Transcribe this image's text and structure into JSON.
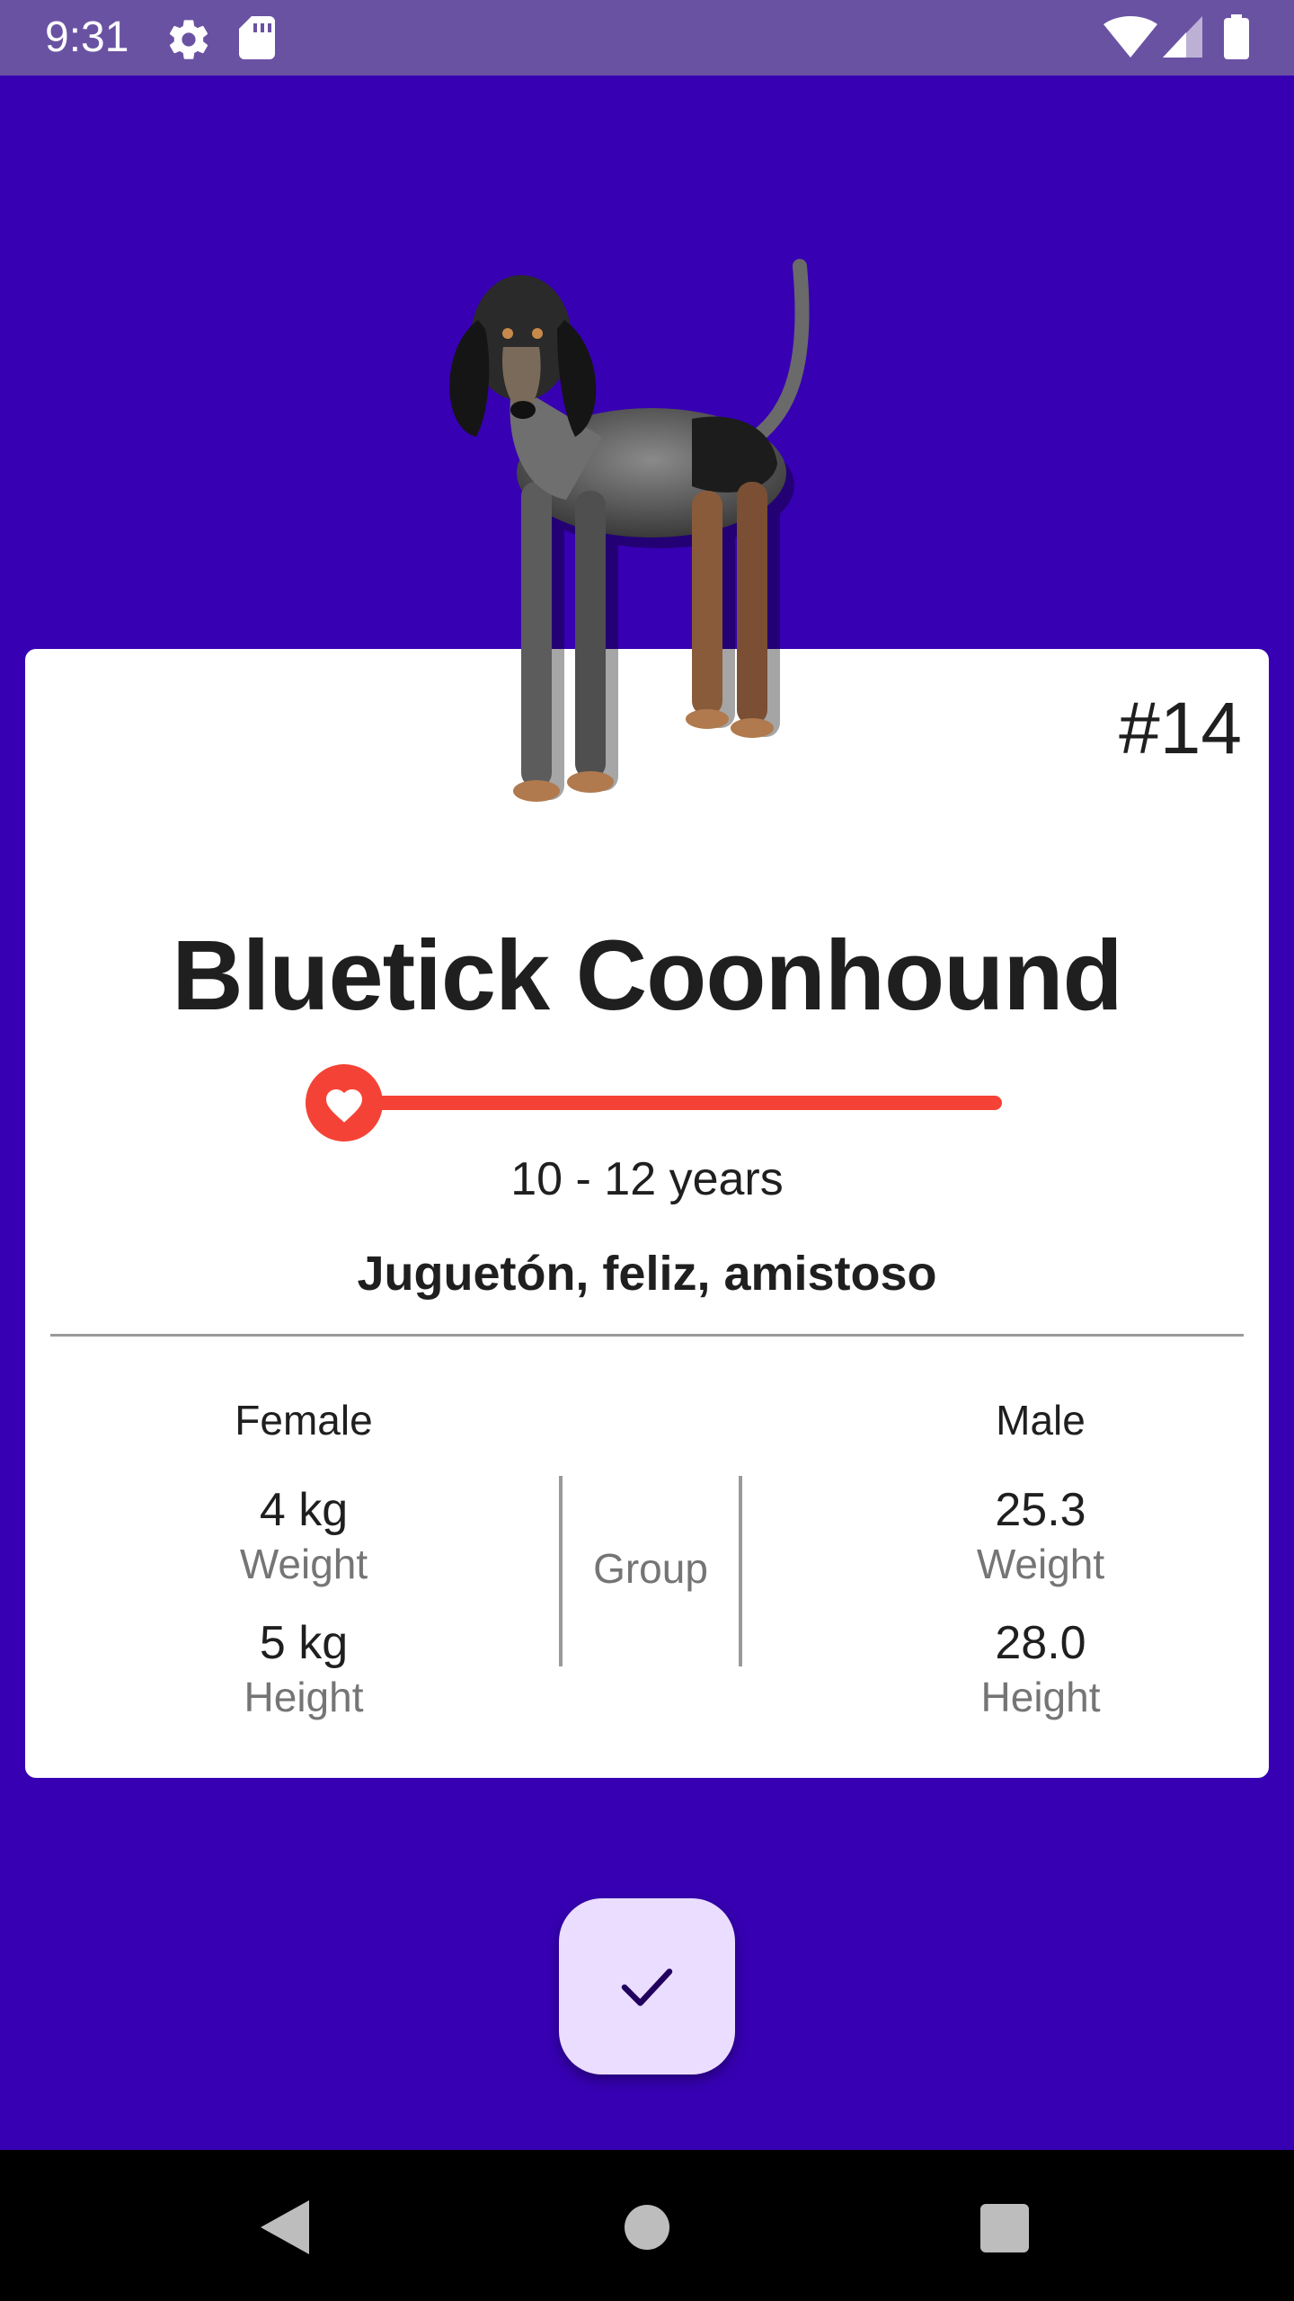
{
  "status_bar": {
    "time": "9:31",
    "icons": [
      "gear-icon",
      "sd-card-icon",
      "wifi-icon",
      "signal-icon",
      "battery-icon"
    ]
  },
  "breed": {
    "number": "#14",
    "name": "Bluetick Coonhound",
    "lifespan": "10 - 12 years",
    "temperament": "Juguetón, feliz, amistoso",
    "life_slider_position": 0.0
  },
  "female": {
    "title": "Female",
    "weight_value": "4 kg",
    "weight_label": "Weight",
    "height_value": "5 kg",
    "height_label": "Height"
  },
  "male": {
    "title": "Male",
    "weight_value": "25.3",
    "weight_label": "Weight",
    "height_value": "28.0",
    "height_label": "Height"
  },
  "group": {
    "label": "Group"
  },
  "fab": {
    "icon": "check-icon"
  },
  "nav_bar": {
    "icons": [
      "back-icon",
      "home-icon",
      "recents-icon"
    ]
  },
  "colors": {
    "background": "#3700B3",
    "status_bar": "#6A52A3",
    "slider": "#F44336",
    "fab": "#EADDFF"
  }
}
